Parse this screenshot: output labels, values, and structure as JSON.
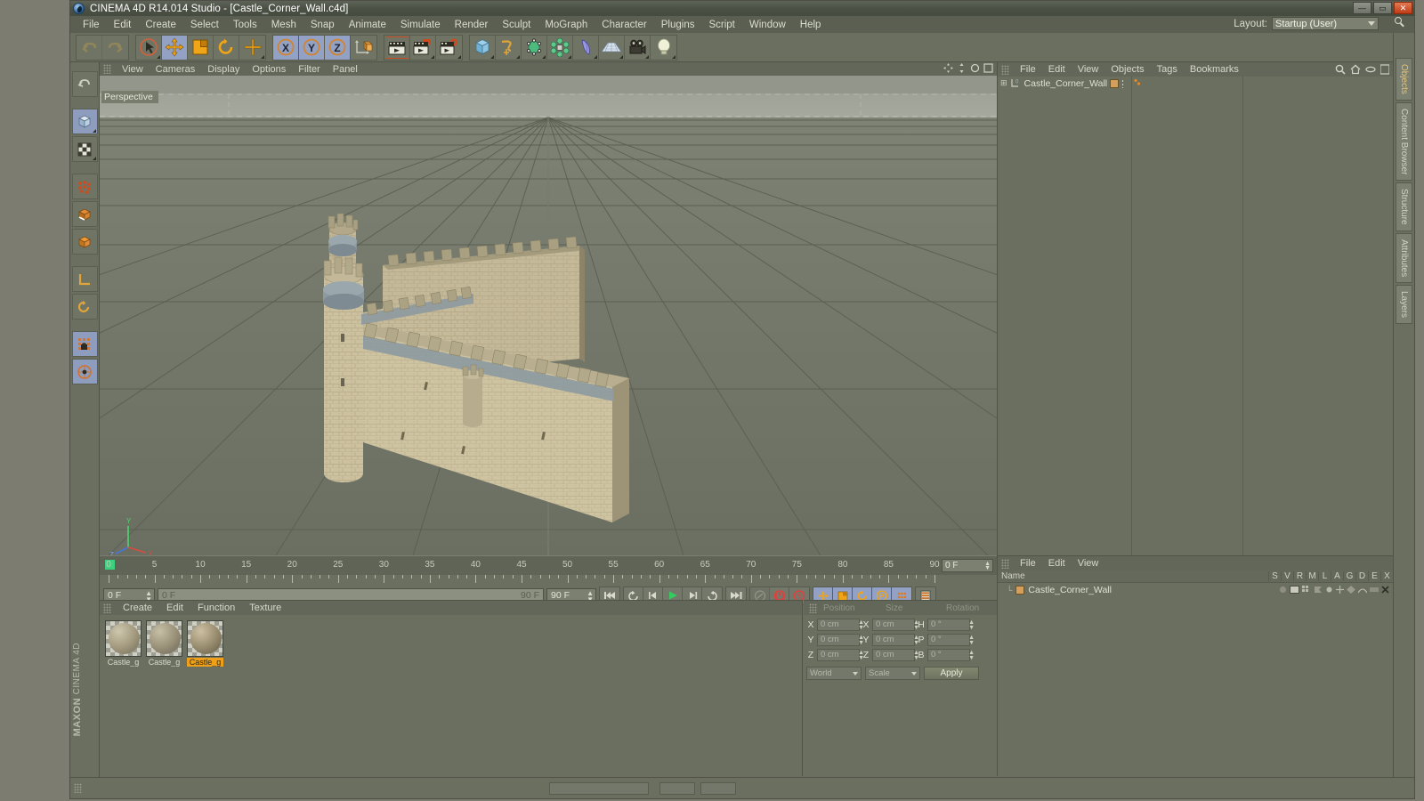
{
  "app": {
    "title": "CINEMA 4D R14.014 Studio - [Castle_Corner_Wall.c4d]",
    "brand_top": "MAXON",
    "brand_bottom": "CINEMA 4D"
  },
  "window_buttons": {
    "minimize": "—",
    "maximize": "▭",
    "close": "✕"
  },
  "menubar": {
    "items": [
      "File",
      "Edit",
      "Create",
      "Select",
      "Tools",
      "Mesh",
      "Snap",
      "Animate",
      "Simulate",
      "Render",
      "Sculpt",
      "MoGraph",
      "Character",
      "Plugins",
      "Script",
      "Window",
      "Help"
    ]
  },
  "layout": {
    "label": "Layout:",
    "value": "Startup (User)"
  },
  "toolbar": {
    "groups": [
      {
        "name": "history",
        "buttons": [
          {
            "name": "undo-button",
            "icon": "undo-icon",
            "state": "disabled"
          },
          {
            "name": "redo-button",
            "icon": "redo-icon",
            "state": "disabled"
          }
        ]
      },
      {
        "name": "transform",
        "buttons": [
          {
            "name": "live-selection-button",
            "icon": "cursor-circle-icon",
            "state": "normal"
          },
          {
            "name": "move-button",
            "icon": "move-arrows-icon",
            "state": "active"
          },
          {
            "name": "scale-button",
            "icon": "scale-square-icon",
            "state": "normal"
          },
          {
            "name": "rotate-button",
            "icon": "rotate-arc-icon",
            "state": "normal"
          },
          {
            "name": "cursor-plus-button",
            "icon": "plus-icon",
            "state": "normal"
          }
        ]
      },
      {
        "name": "axis-lock",
        "buttons": [
          {
            "name": "lock-x-button",
            "icon": "x-axis-icon",
            "label": "X",
            "state": "active"
          },
          {
            "name": "lock-y-button",
            "icon": "y-axis-icon",
            "label": "Y",
            "state": "active"
          },
          {
            "name": "lock-z-button",
            "icon": "z-axis-icon",
            "label": "Z",
            "state": "active"
          },
          {
            "name": "world-object-axis-button",
            "icon": "world-axis-cube-icon",
            "state": "normal"
          }
        ]
      },
      {
        "name": "render",
        "buttons": [
          {
            "name": "render-view-button",
            "icon": "clapperboard-icon",
            "state": "highlight"
          },
          {
            "name": "render-region-button",
            "icon": "clapperboard-region-icon",
            "state": "normal"
          },
          {
            "name": "render-settings-button",
            "icon": "clapperboard-gear-icon",
            "state": "normal"
          }
        ]
      },
      {
        "name": "create",
        "buttons": [
          {
            "name": "add-cube-button",
            "icon": "cube-icon",
            "state": "normal"
          },
          {
            "name": "add-spline-button",
            "icon": "spline-icon",
            "state": "normal"
          },
          {
            "name": "add-nurbs-button",
            "icon": "nurbs-icon",
            "state": "normal"
          },
          {
            "name": "add-array-button",
            "icon": "array-icon",
            "state": "normal"
          },
          {
            "name": "add-deformer-button",
            "icon": "bend-deformer-icon",
            "state": "normal"
          },
          {
            "name": "add-floor-button",
            "icon": "floor-icon",
            "state": "normal"
          },
          {
            "name": "add-camera-button",
            "icon": "camera-icon",
            "state": "normal"
          },
          {
            "name": "add-light-button",
            "icon": "light-bulb-icon",
            "state": "normal"
          }
        ]
      }
    ]
  },
  "left_toolbar": {
    "buttons": [
      {
        "name": "undo-view-button",
        "icon": "undo-view-icon"
      },
      {
        "name": "make-editable-button",
        "icon": "make-editable-icon"
      },
      {
        "name": "model-mode-button",
        "icon": "model-cube-icon",
        "state": "active"
      },
      {
        "name": "texture-mode-button",
        "icon": "texture-checker-icon"
      },
      {
        "name": "points-mode-button",
        "icon": "points-icon"
      },
      {
        "name": "edges-mode-button",
        "icon": "edges-icon"
      },
      {
        "name": "polygons-mode-button",
        "icon": "polygons-icon"
      },
      {
        "name": "normal-move-button",
        "icon": "normal-move-icon"
      },
      {
        "name": "viewport-solo-button",
        "icon": "viewport-solo-icon"
      },
      {
        "name": "enable-axis-button",
        "icon": "axis-lock-icon",
        "state": "active"
      },
      {
        "name": "workplane-button",
        "icon": "workplane-icon",
        "state": "active"
      }
    ]
  },
  "viewport": {
    "menu": [
      "View",
      "Cameras",
      "Display",
      "Options",
      "Filter",
      "Panel"
    ],
    "label": "Perspective",
    "icons": [
      "pan-icon",
      "zoom-icon",
      "rotate-icon",
      "maximize-view-icon"
    ],
    "axis_gizmo": {
      "y": "Y",
      "x": "X",
      "z": "Z"
    }
  },
  "timeline": {
    "tick_labels": [
      "0",
      "5",
      "10",
      "15",
      "20",
      "25",
      "30",
      "35",
      "40",
      "45",
      "50",
      "55",
      "60",
      "65",
      "70",
      "75",
      "80",
      "85",
      "90"
    ],
    "current_frame_box": "0 F",
    "current_frame_field": "0 F",
    "range_start": "0 F",
    "range_end": "90 F",
    "preview_end": "90 F"
  },
  "transport": {
    "buttons": [
      {
        "name": "go-to-start-button",
        "icon": "skip-back-icon"
      },
      {
        "name": "play-back-loop-button",
        "icon": "loop-back-icon"
      },
      {
        "name": "previous-frame-button",
        "icon": "step-back-icon"
      },
      {
        "name": "play-button",
        "icon": "play-icon"
      },
      {
        "name": "next-frame-button",
        "icon": "step-forward-icon"
      },
      {
        "name": "play-forward-loop-button",
        "icon": "loop-forward-icon"
      },
      {
        "name": "go-to-end-button",
        "icon": "skip-forward-icon"
      }
    ],
    "record_buttons": [
      {
        "name": "record-active-objects-button",
        "icon": "key-icon",
        "state": "disabled"
      },
      {
        "name": "autokeying-button",
        "icon": "power-record-icon",
        "state": "red"
      },
      {
        "name": "keyframe-selection-button",
        "icon": "question-record-icon",
        "state": "red"
      }
    ],
    "key_toggles": [
      {
        "name": "key-position-button",
        "icon": "position-key-icon",
        "state": "active"
      },
      {
        "name": "key-scale-button",
        "icon": "scale-key-icon",
        "state": "active"
      },
      {
        "name": "key-rotation-button",
        "icon": "rotation-key-icon",
        "state": "active"
      },
      {
        "name": "key-parameter-button",
        "icon": "param-key-icon",
        "state": "active"
      },
      {
        "name": "key-pla-button",
        "icon": "pla-key-icon",
        "state": "active"
      }
    ],
    "extra_buttons": [
      {
        "name": "timeline-toggle-button",
        "icon": "timeline-bars-icon"
      }
    ]
  },
  "material_manager": {
    "menu": [
      "Create",
      "Edit",
      "Function",
      "Texture"
    ],
    "materials": [
      {
        "name": "Castle_g",
        "selected": false,
        "ball_colors": [
          "#cfc7ad",
          "#a39a7f",
          "#6f6a57"
        ]
      },
      {
        "name": "Castle_g",
        "selected": false,
        "ball_colors": [
          "#c7bfa6",
          "#9a9179",
          "#6a6453"
        ]
      },
      {
        "name": "Castle_g",
        "selected": true,
        "ball_colors": [
          "#cdbfa2",
          "#998d70",
          "#615a47"
        ]
      }
    ]
  },
  "coordinates": {
    "header": [
      "Position",
      "Size",
      "Rotation"
    ],
    "rows": [
      {
        "axis1": "X",
        "value1": "0 cm",
        "axis2": "X",
        "value2": "0 cm",
        "axis3": "H",
        "value3": "0 °"
      },
      {
        "axis1": "Y",
        "value1": "0 cm",
        "axis2": "Y",
        "value2": "0 cm",
        "axis3": "P",
        "value3": "0 °"
      },
      {
        "axis1": "Z",
        "value1": "0 cm",
        "axis2": "Z",
        "value2": "0 cm",
        "axis3": "B",
        "value3": "0 °"
      }
    ],
    "system": "World",
    "mode": "Scale",
    "apply_label": "Apply"
  },
  "object_manager": {
    "menu": [
      "File",
      "Edit",
      "View",
      "Objects",
      "Tags",
      "Bookmarks"
    ],
    "tools": [
      "search-icon",
      "home-icon",
      "ellipse-icon",
      "filter-icon"
    ],
    "items": [
      {
        "name": "Castle_Corner_Wall",
        "level_badge": "0",
        "has_tag": true
      }
    ]
  },
  "attribute_manager": {
    "menu": [
      "File",
      "Edit",
      "View"
    ],
    "columns": [
      "Name",
      "S",
      "V",
      "R",
      "M",
      "L",
      "A",
      "G",
      "D",
      "E",
      "X"
    ],
    "rows": [
      {
        "name": "Castle_Corner_Wall"
      }
    ]
  },
  "right_tabs": [
    {
      "label": "Objects",
      "accent": true
    },
    {
      "label": "Content Browser",
      "accent": false
    },
    {
      "label": "Structure",
      "accent": false
    },
    {
      "label": "Attributes",
      "accent": false
    },
    {
      "label": "Layers",
      "accent": false
    }
  ]
}
